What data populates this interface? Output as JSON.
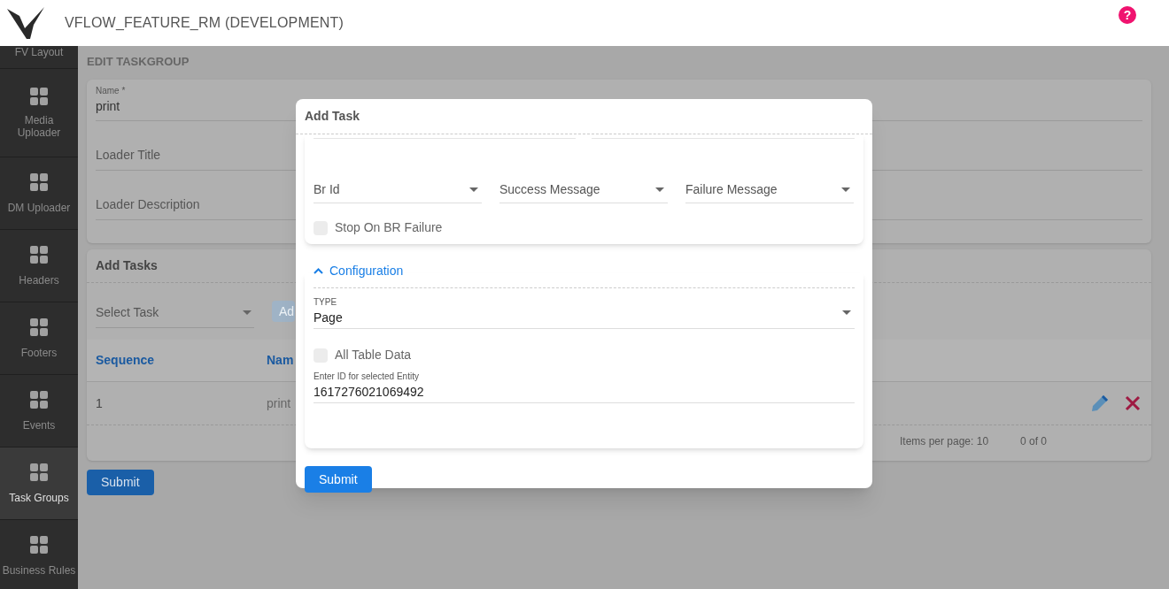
{
  "header": {
    "title": "VFLOW_FEATURE_RM (DEVELOPMENT)",
    "help": "?"
  },
  "sidebar": {
    "items": [
      {
        "label": "FV Layout",
        "kind": "cut",
        "selected": false
      },
      {
        "label": "Media Uploader",
        "kind": "full",
        "selected": false
      },
      {
        "label": "DM Uploader",
        "kind": "full",
        "selected": false
      },
      {
        "label": "Headers",
        "kind": "full",
        "selected": false
      },
      {
        "label": "Footers",
        "kind": "full",
        "selected": false
      },
      {
        "label": "Events",
        "kind": "full",
        "selected": false
      },
      {
        "label": "Task Groups",
        "kind": "full",
        "selected": true
      },
      {
        "label": "Business Rules",
        "kind": "full",
        "selected": false
      }
    ]
  },
  "page": {
    "heading": "EDIT TASKGROUP",
    "fields": [
      {
        "label": "Name *",
        "value": "print"
      },
      {
        "placeholder": "Loader Title"
      },
      {
        "placeholder": "Loader Description"
      }
    ],
    "tasks": {
      "title": "Add Tasks",
      "select": {
        "placeholder": "Select Task"
      },
      "add_button": {
        "label": "Ad",
        "disabled": true
      },
      "columns": [
        "Sequence",
        "Nam"
      ],
      "rows": [
        {
          "cells": [
            "1",
            "print"
          ]
        }
      ],
      "paginator": {
        "items_per_page": "Items per page: 10",
        "range": "0 of 0"
      }
    },
    "submit": "Submit"
  },
  "modal": {
    "title": "Add Task",
    "rule_selects": [
      {
        "placeholder": "Br Id"
      },
      {
        "placeholder": "Success Message"
      },
      {
        "placeholder": "Failure Message"
      }
    ],
    "stop_on_failure": {
      "label": "Stop On BR Failure",
      "checked": false
    },
    "configuration": {
      "title": "Configuration",
      "expanded": true,
      "type": {
        "label": "TYPE",
        "value": "Page"
      },
      "all_table_data": {
        "label": "All Table Data",
        "checked": false
      },
      "entity_id": {
        "label": "Enter ID for selected Entity",
        "value": "1617276021069492"
      }
    },
    "submit": "Submit"
  }
}
